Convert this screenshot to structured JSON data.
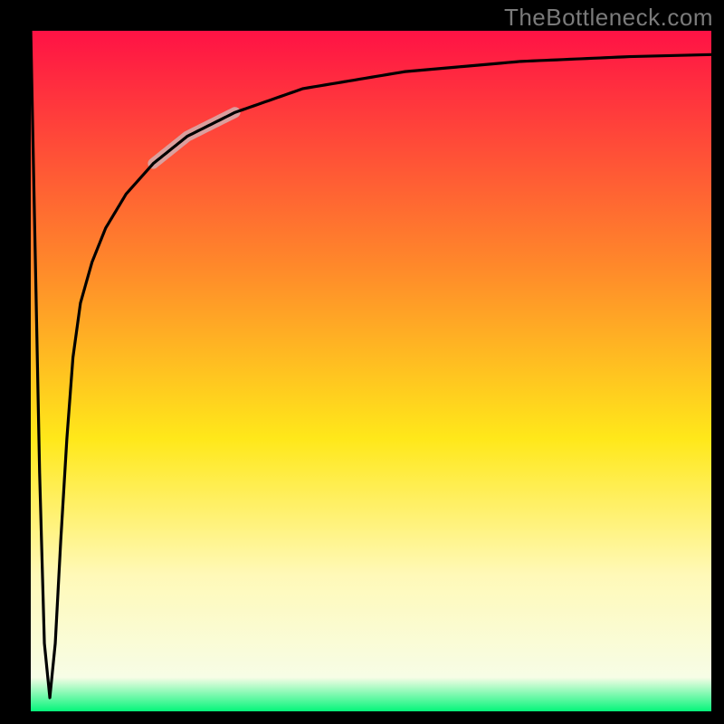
{
  "watermark": "TheBottleneck.com",
  "chart_data": {
    "type": "line",
    "title": "",
    "xlabel": "",
    "ylabel": "",
    "xlim": [
      0,
      100
    ],
    "ylim": [
      0,
      100
    ],
    "grid": false,
    "legend": false,
    "background_gradient": {
      "stops": [
        {
          "offset": 0.0,
          "color": "#ff1245"
        },
        {
          "offset": 0.35,
          "color": "#ff8a2a"
        },
        {
          "offset": 0.6,
          "color": "#ffe81a"
        },
        {
          "offset": 0.8,
          "color": "#fff9b8"
        },
        {
          "offset": 0.95,
          "color": "#f7fde6"
        },
        {
          "offset": 1.0,
          "color": "#05f57a"
        }
      ]
    },
    "series": [
      {
        "name": "curve",
        "x": [
          0.0,
          0.5,
          1.3,
          2.0,
          2.8,
          3.6,
          4.4,
          5.3,
          6.2,
          7.3,
          9.0,
          11.0,
          14.0,
          18.0,
          23.0,
          30.0,
          40.0,
          55.0,
          72.0,
          88.0,
          100.0
        ],
        "y": [
          100.0,
          75.0,
          35.0,
          10.0,
          2.0,
          10.0,
          25.0,
          40.0,
          52.0,
          60.0,
          66.0,
          71.0,
          76.0,
          80.5,
          84.5,
          88.0,
          91.5,
          94.0,
          95.5,
          96.2,
          96.5
        ]
      }
    ],
    "highlight_segment": {
      "series": "curve",
      "x_start": 18.0,
      "x_end": 30.0,
      "color": "#d7a8a8",
      "width": 12
    },
    "frame": {
      "inner_left": 34,
      "inner_top": 34,
      "inner_right": 786,
      "inner_bottom": 786,
      "stroke": "#000000",
      "stroke_width": 34
    }
  }
}
